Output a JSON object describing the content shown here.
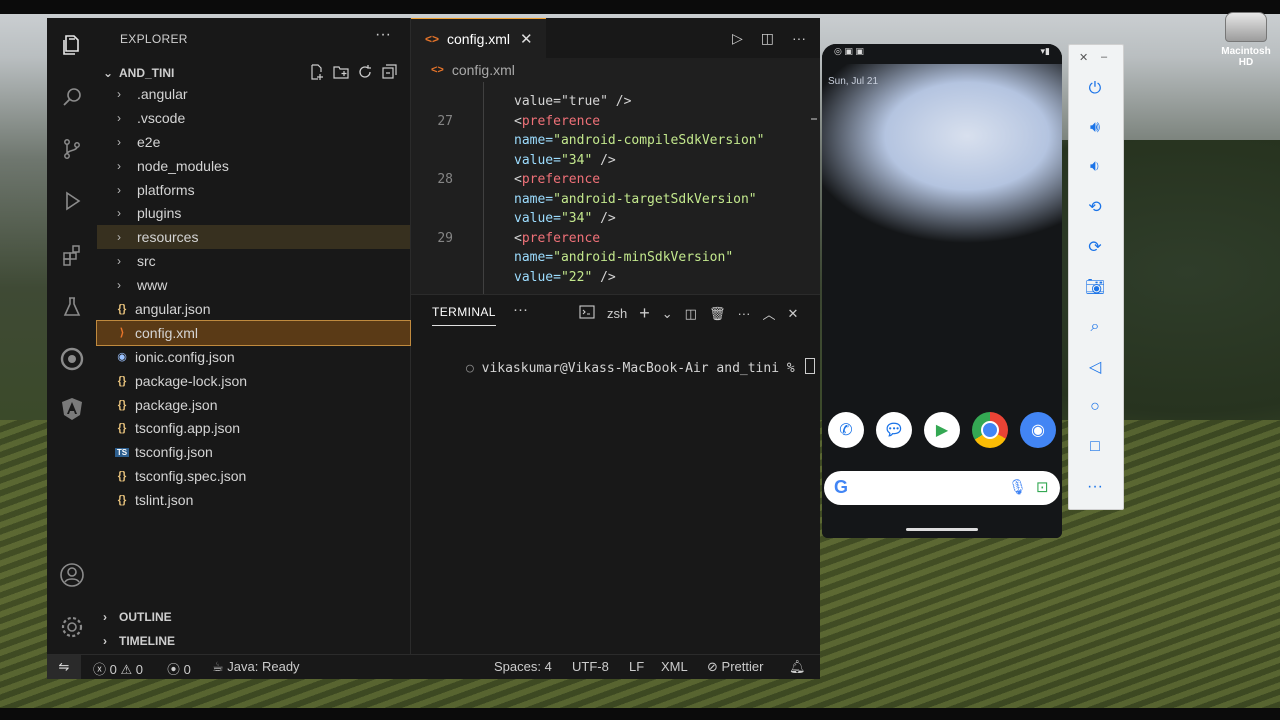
{
  "desktop": {
    "disk_label": "Macintosh HD"
  },
  "explorer": {
    "title": "EXPLORER",
    "root": "AND_TINI",
    "items": [
      {
        "label": ".angular",
        "type": "folder",
        "state": "normal"
      },
      {
        "label": ".vscode",
        "type": "folder",
        "state": "normal"
      },
      {
        "label": "e2e",
        "type": "folder",
        "state": "normal"
      },
      {
        "label": "node_modules",
        "type": "folder",
        "state": "normal"
      },
      {
        "label": "platforms",
        "type": "folder",
        "state": "normal"
      },
      {
        "label": "plugins",
        "type": "folder",
        "state": "normal"
      },
      {
        "label": "resources",
        "type": "folder",
        "state": "hover"
      },
      {
        "label": "src",
        "type": "folder",
        "state": "normal"
      },
      {
        "label": "www",
        "type": "folder",
        "state": "normal"
      },
      {
        "label": "angular.json",
        "type": "json",
        "state": "normal"
      },
      {
        "label": "config.xml",
        "type": "xml",
        "state": "selected"
      },
      {
        "label": "ionic.config.json",
        "type": "ionic",
        "state": "normal"
      },
      {
        "label": "package-lock.json",
        "type": "json",
        "state": "normal"
      },
      {
        "label": "package.json",
        "type": "json",
        "state": "normal"
      },
      {
        "label": "tsconfig.app.json",
        "type": "json",
        "state": "normal"
      },
      {
        "label": "tsconfig.json",
        "type": "ts",
        "state": "normal"
      },
      {
        "label": "tsconfig.spec.json",
        "type": "json",
        "state": "normal"
      },
      {
        "label": "tslint.json",
        "type": "json",
        "state": "normal"
      }
    ],
    "outline": "OUTLINE",
    "timeline": "TIMELINE"
  },
  "editor": {
    "tab": "config.xml",
    "breadcrumb": "config.xml",
    "lines": [
      {
        "n": "",
        "parts": [
          [
            "punct",
            "value=\"true\" />"
          ]
        ]
      },
      {
        "n": "27",
        "parts": [
          [
            "punct",
            "<"
          ],
          [
            "tag",
            "preference"
          ]
        ]
      },
      {
        "n": "",
        "parts": [
          [
            "attr",
            "name="
          ],
          [
            "val",
            "\"android-compileSdkVersion\""
          ]
        ]
      },
      {
        "n": "",
        "parts": [
          [
            "attr",
            "value="
          ],
          [
            "val",
            "\"34\""
          ],
          [
            "punct",
            " />"
          ]
        ]
      },
      {
        "n": "28",
        "parts": [
          [
            "punct",
            "<"
          ],
          [
            "tag",
            "preference"
          ]
        ]
      },
      {
        "n": "",
        "parts": [
          [
            "attr",
            "name="
          ],
          [
            "val",
            "\"android-targetSdkVersion\""
          ]
        ]
      },
      {
        "n": "",
        "parts": [
          [
            "attr",
            "value="
          ],
          [
            "val",
            "\"34\""
          ],
          [
            "punct",
            " />"
          ]
        ]
      },
      {
        "n": "29",
        "parts": [
          [
            "punct",
            "<"
          ],
          [
            "tag",
            "preference"
          ]
        ]
      },
      {
        "n": "",
        "parts": [
          [
            "attr",
            "name="
          ],
          [
            "val",
            "\"android-minSdkVersion\""
          ]
        ]
      },
      {
        "n": "",
        "parts": [
          [
            "attr",
            "value="
          ],
          [
            "val",
            "\"22\""
          ],
          [
            "punct",
            " />"
          ]
        ]
      }
    ]
  },
  "terminal": {
    "tab": "TERMINAL",
    "shell": "zsh",
    "prompt": "vikaskumar@Vikass-MacBook-Air and_tini % "
  },
  "statusbar": {
    "errors": "0",
    "warnings": "0",
    "ports": "0",
    "java": "Java: Ready",
    "spaces": "Spaces: 4",
    "encoding": "UTF-8",
    "eol": "LF",
    "language": "XML",
    "prettier": "Prettier"
  },
  "emulator": {
    "date": "Sun, Jul 21",
    "apps": [
      "Phone",
      "Messages",
      "Play Store",
      "Chrome",
      "Camera"
    ]
  },
  "colors": {
    "accent": "#f0a030",
    "selected_bg": "#5a3a16",
    "xml_icon": "#e8752a",
    "json_icon": "#e5c07b",
    "emulator_blue": "#1a73e8"
  }
}
